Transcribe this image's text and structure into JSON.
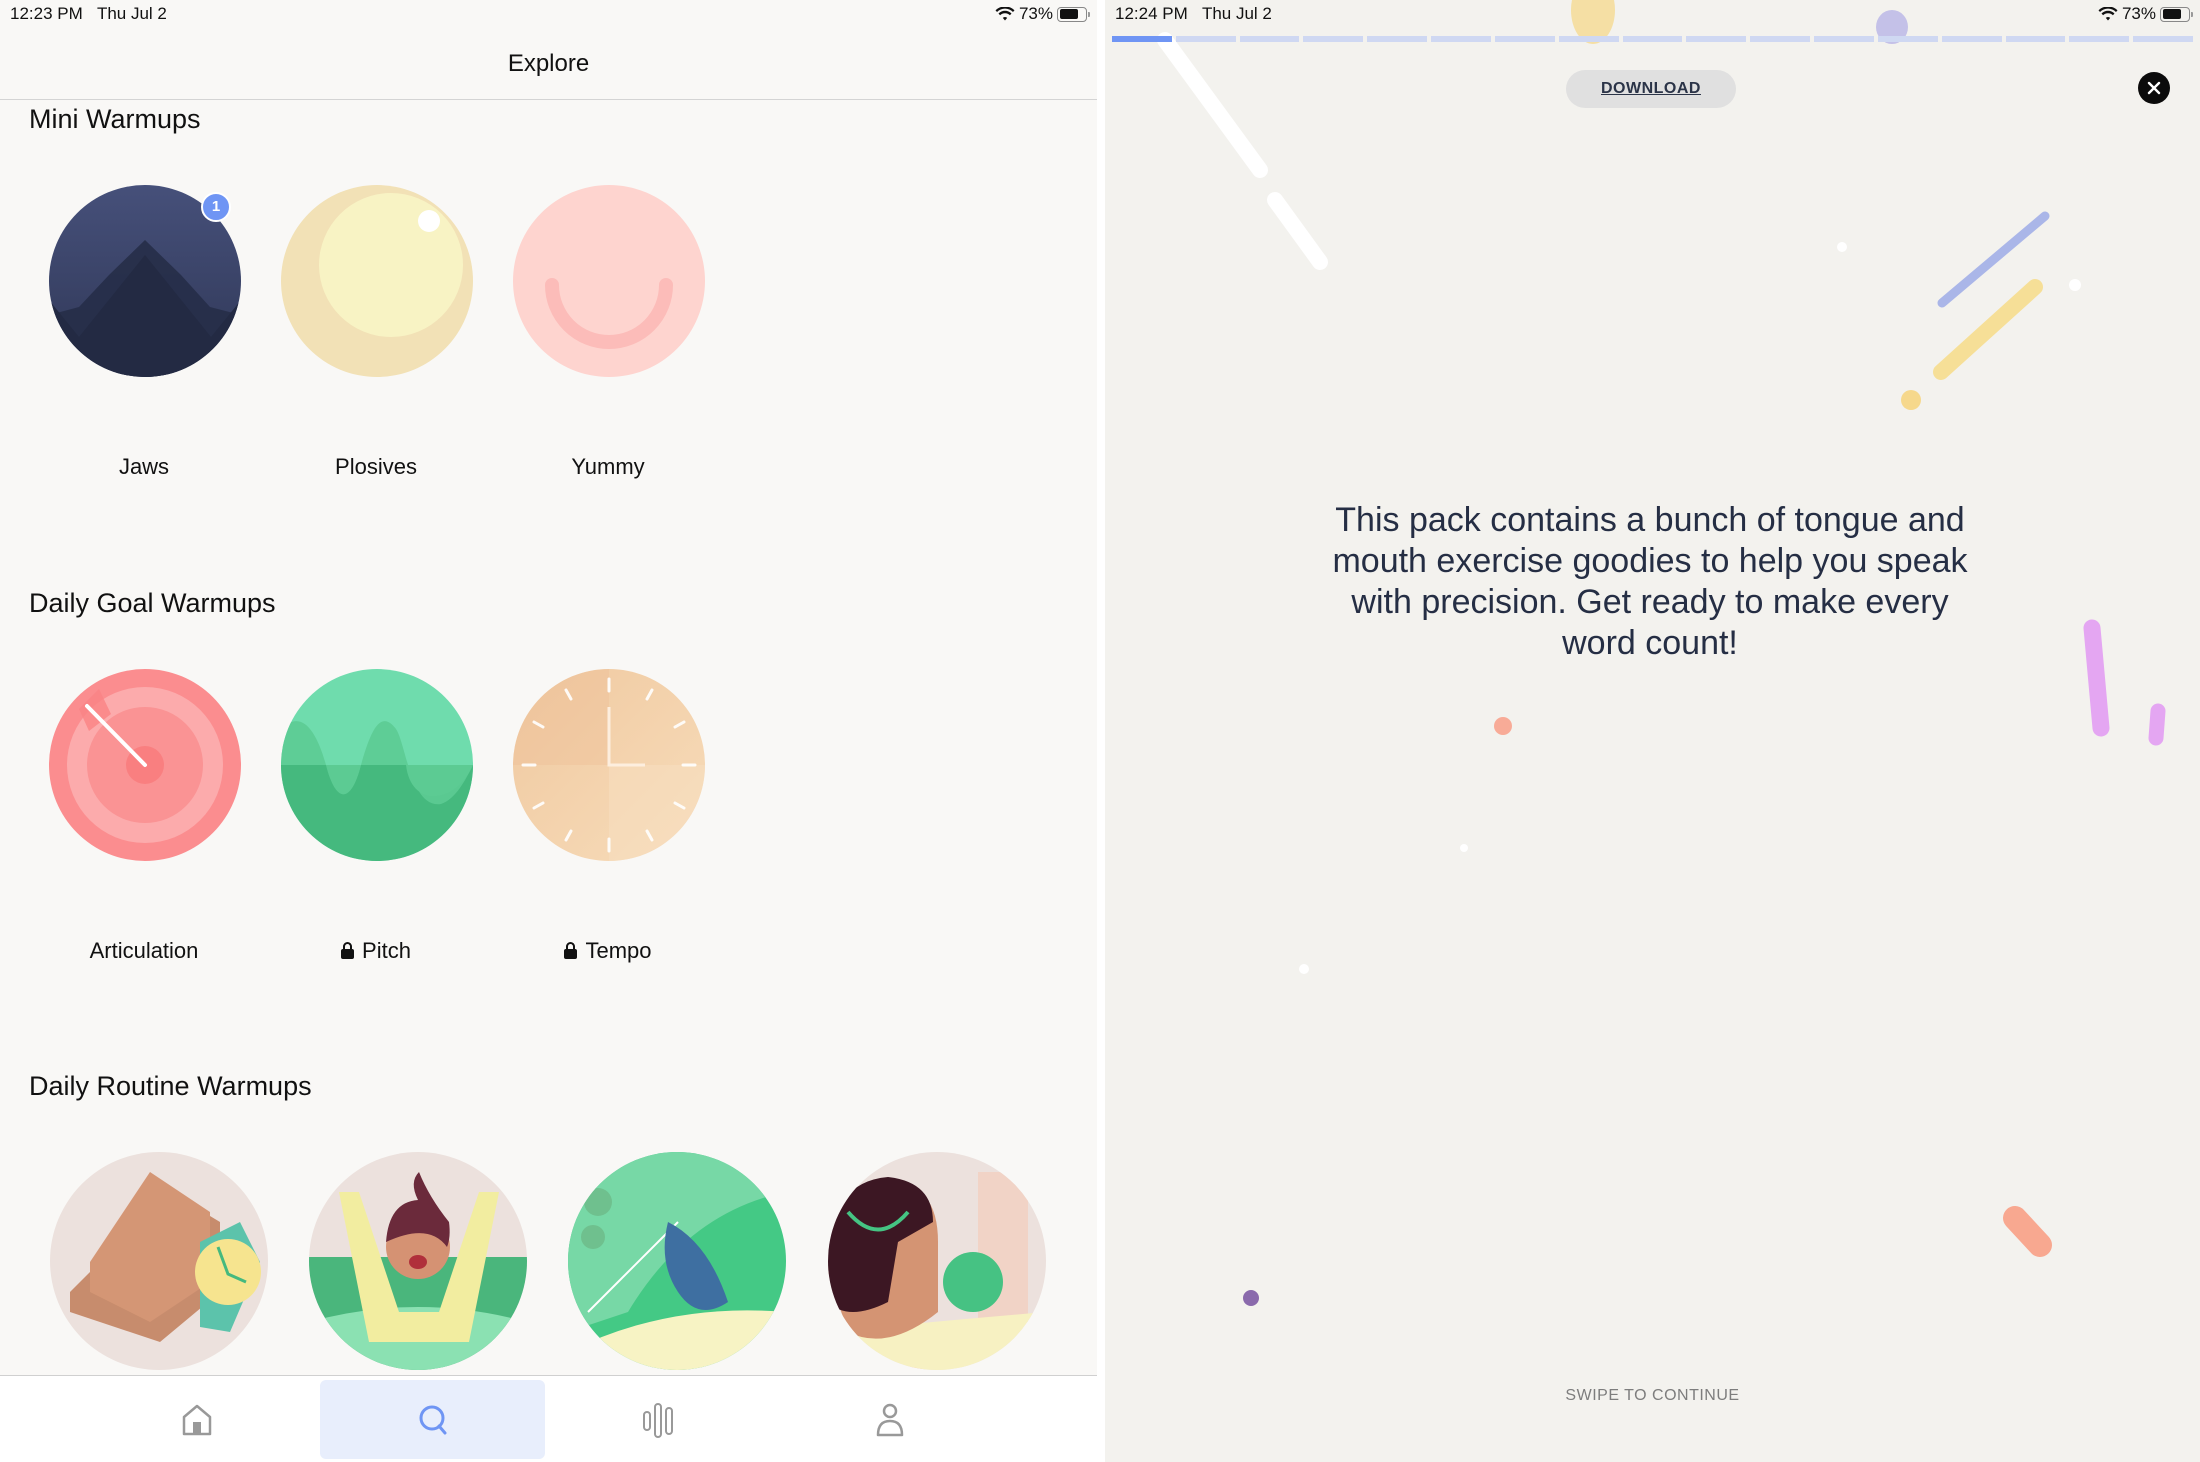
{
  "left_screen": {
    "status_bar": {
      "time": "12:23 PM",
      "date": "Thu Jul 2",
      "battery": "73%",
      "wifi_icon": "wifi-icon",
      "battery_icon": "battery-icon"
    },
    "nav_title": "Explore",
    "sections": [
      {
        "title": "Mini Warmups",
        "items": [
          {
            "label": "Jaws",
            "icon": "mountain-illustration",
            "badge": "1",
            "locked": false
          },
          {
            "label": "Plosives",
            "icon": "bubble-illustration",
            "locked": false
          },
          {
            "label": "Yummy",
            "icon": "smile-illustration",
            "locked": false
          }
        ]
      },
      {
        "title": "Daily Goal Warmups",
        "items": [
          {
            "label": "Articulation",
            "icon": "target-illustration",
            "locked": false
          },
          {
            "label": "Pitch",
            "icon": "wave-illustration",
            "locked": true
          },
          {
            "label": "Tempo",
            "icon": "clock-illustration",
            "locked": true
          }
        ]
      },
      {
        "title": "Daily Routine Warmups",
        "items": [
          {
            "icon": "wristwatch-illustration"
          },
          {
            "icon": "cheering-person-illustration"
          },
          {
            "icon": "bird-illustration"
          },
          {
            "icon": "headband-person-illustration"
          }
        ]
      }
    ],
    "tab_bar": [
      {
        "name": "home",
        "icon": "home-icon",
        "active": false
      },
      {
        "name": "explore",
        "icon": "search-icon",
        "active": true
      },
      {
        "name": "stats",
        "icon": "bars-icon",
        "active": false
      },
      {
        "name": "profile",
        "icon": "person-icon",
        "active": false
      }
    ],
    "colors": {
      "accent": "#6f95f4",
      "active_tab_bg": "#e8eefc"
    }
  },
  "right_screen": {
    "status_bar": {
      "time": "12:24 PM",
      "date": "Thu Jul 2",
      "battery": "73%"
    },
    "progress": {
      "total_steps": 17,
      "current_step": 1
    },
    "download_label": "DOWNLOAD",
    "close_icon": "close-icon",
    "description": "This pack contains a bunch of tongue and mouth exercise goodies to help you speak with precision. Get ready to make every word count!",
    "swipe_hint": "SWIPE TO CONTINUE"
  }
}
